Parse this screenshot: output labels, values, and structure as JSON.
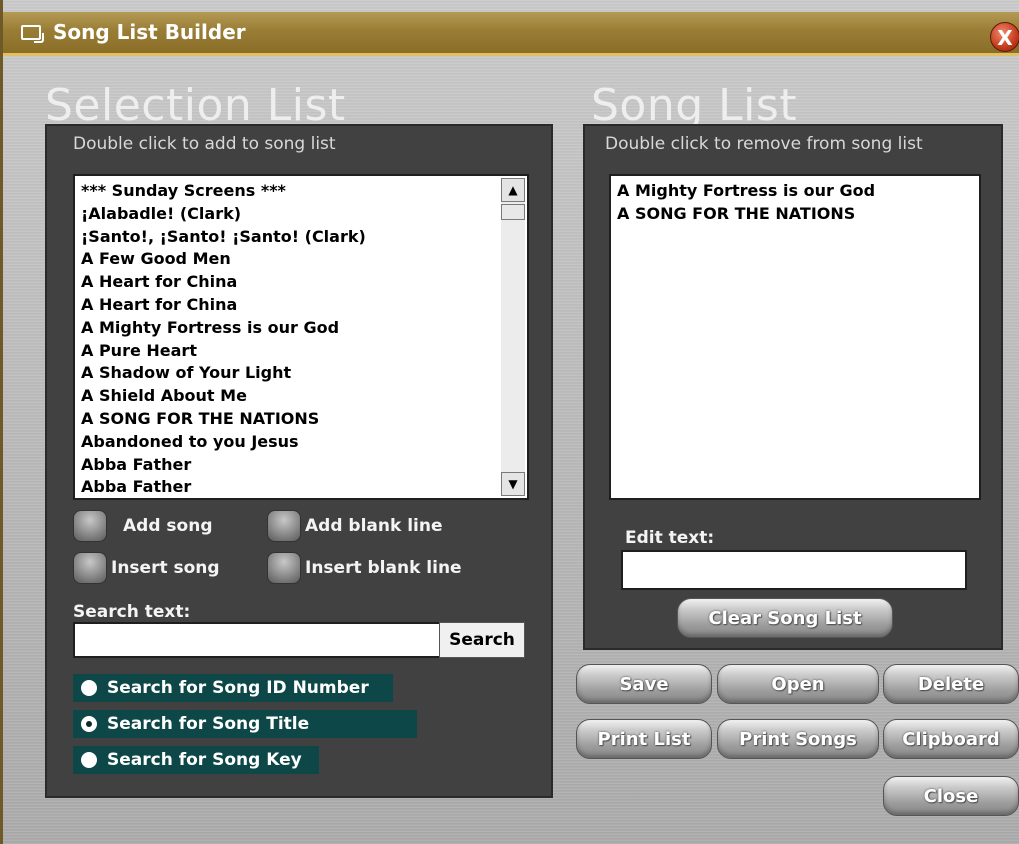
{
  "window": {
    "title": "Song List Builder",
    "close_label": "X"
  },
  "selection": {
    "title": "Selection List",
    "hint": "Double click to add to song list",
    "songs": [
      "*** Sunday Screens ***",
      "¡Alabadle! (Clark)",
      "¡Santo!, ¡Santo! ¡Santo! (Clark)",
      "A Few Good Men",
      "A Heart for China",
      "A Heart for China",
      "A Mighty Fortress is our God",
      "A Pure Heart",
      "A Shadow of Your Light",
      "A Shield About Me",
      "A SONG FOR THE NATIONS",
      "Abandoned to you Jesus",
      "Abba Father",
      "Abba Father"
    ],
    "scroll_up": "▲",
    "scroll_down": "▼",
    "options": {
      "add_song": "Add song",
      "add_blank": "Add blank line",
      "insert_song": "Insert song",
      "insert_blank": "Insert blank line"
    },
    "search_label": "Search text:",
    "search_value": "",
    "search_button": "Search",
    "search_modes": [
      {
        "label": "Search for Song ID Number",
        "selected": false
      },
      {
        "label": "Search for Song Title",
        "selected": true
      },
      {
        "label": "Search for Song Key",
        "selected": false
      }
    ]
  },
  "songlist": {
    "title": "Song List",
    "hint": "Double click to remove from song list",
    "songs": [
      "A Mighty Fortress is our God",
      "A SONG FOR THE NATIONS"
    ],
    "edit_label": "Edit text:",
    "edit_value": "",
    "clear_button": "Clear Song List"
  },
  "actions": {
    "save": "Save",
    "open": "Open",
    "delete": "Delete",
    "print_list": "Print List",
    "print_songs": "Print Songs",
    "clipboard": "Clipboard",
    "close": "Close"
  }
}
